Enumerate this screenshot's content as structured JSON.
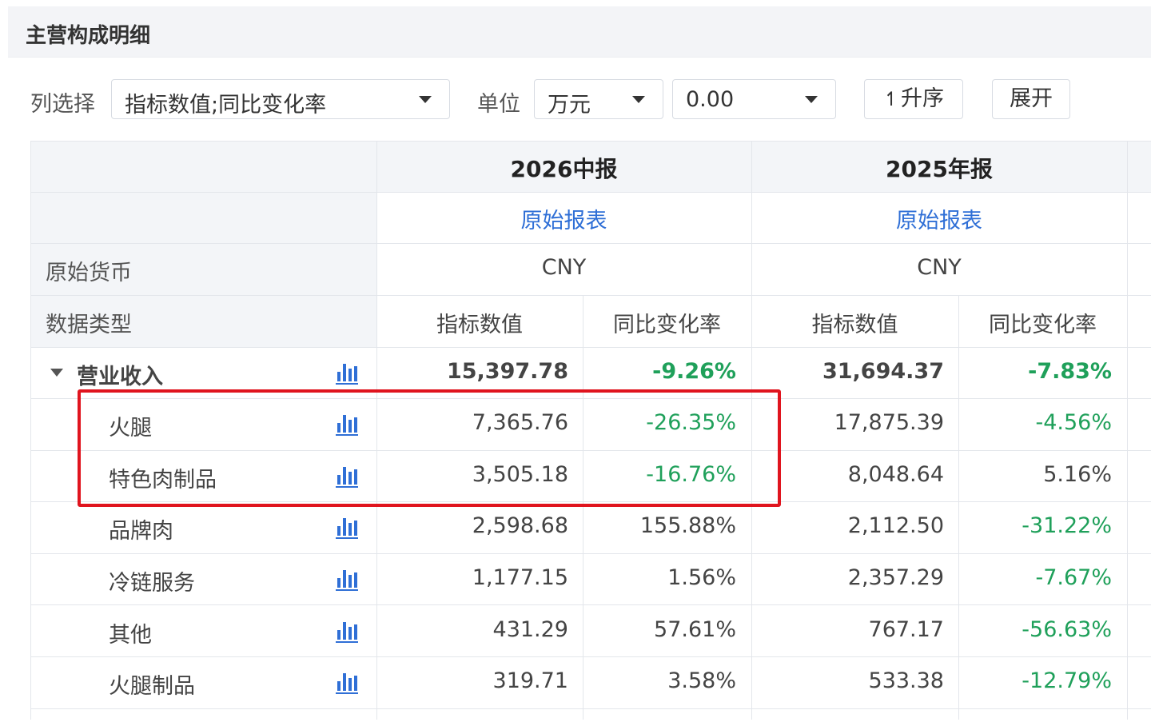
{
  "panel": {
    "title": "主营构成明细"
  },
  "toolbar": {
    "column_select_label": "列选择",
    "column_select_value": "指标数值;同比变化率",
    "unit_label": "单位",
    "unit_value": "万元",
    "precision_value": "0.00",
    "sort_icon": "↿",
    "sort_label": "升序",
    "expand_label": "展开"
  },
  "table": {
    "periods": [
      {
        "name": "2026中报",
        "source": "原始报表",
        "currency": "CNY"
      },
      {
        "name": "2025年报",
        "source": "原始报表",
        "currency": "CNY"
      }
    ],
    "currency_row_label": "原始货币",
    "datatype_row_label": "数据类型",
    "col_value_label": "指标数值",
    "col_yoy_label": "同比变化率",
    "chart_icon": "bar-chart-icon",
    "rows": [
      {
        "name": "营业收入",
        "v1": "15,397.78",
        "y1": "-9.26%",
        "v2": "31,694.37",
        "y2": "-7.83%"
      },
      {
        "name": "火腿",
        "v1": "7,365.76",
        "y1": "-26.35%",
        "v2": "17,875.39",
        "y2": "-4.56%"
      },
      {
        "name": "特色肉制品",
        "v1": "3,505.18",
        "y1": "-16.76%",
        "v2": "8,048.64",
        "y2": "5.16%"
      },
      {
        "name": "品牌肉",
        "v1": "2,598.68",
        "y1": "155.88%",
        "v2": "2,112.50",
        "y2": "-31.22%"
      },
      {
        "name": "冷链服务",
        "v1": "1,177.15",
        "y1": "1.56%",
        "v2": "2,357.29",
        "y2": "-7.67%"
      },
      {
        "name": "其他",
        "v1": "431.29",
        "y1": "57.61%",
        "v2": "767.17",
        "y2": "-56.63%"
      },
      {
        "name": "火腿制品",
        "v1": "319.71",
        "y1": "3.58%",
        "v2": "533.38",
        "y2": "-12.79%"
      }
    ]
  },
  "colors": {
    "green": "#1fa05a",
    "link": "#2f6fd6",
    "highlight": "#e0141e"
  }
}
